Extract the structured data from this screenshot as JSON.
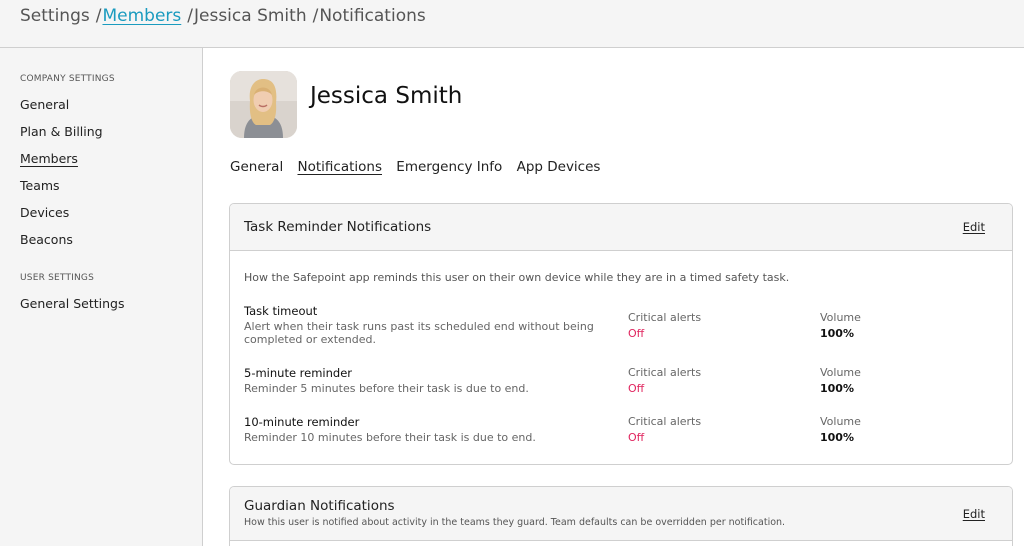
{
  "breadcrumb": {
    "settings": "Settings",
    "members": "Members",
    "member_name": "Jessica Smith",
    "current": "Notifications",
    "separator": "/"
  },
  "sidebar": {
    "company_heading": "COMPANY SETTINGS",
    "company_items": [
      "General",
      "Plan & Billing",
      "Members",
      "Teams",
      "Devices",
      "Beacons"
    ],
    "active_item": "Members",
    "user_heading": "USER SETTINGS",
    "user_items": [
      "General Settings"
    ]
  },
  "profile": {
    "name": "Jessica Smith"
  },
  "tabs": [
    "General",
    "Notifications",
    "Emergency Info",
    "App Devices"
  ],
  "active_tab": "Notifications",
  "task_card": {
    "title": "Task Reminder Notifications",
    "edit_label": "Edit",
    "description": "How the Safepoint app reminds this user on their own device while they are in a timed safety task.",
    "rows": [
      {
        "title": "Task timeout",
        "desc": "Alert when their task runs past its scheduled end without being completed or extended.",
        "alerts_label": "Critical alerts",
        "alerts_value": "Off",
        "volume_label": "Volume",
        "volume_value": "100%"
      },
      {
        "title": "5-minute reminder",
        "desc": "Reminder 5 minutes before their task is due to end.",
        "alerts_label": "Critical alerts",
        "alerts_value": "Off",
        "volume_label": "Volume",
        "volume_value": "100%"
      },
      {
        "title": "10-minute reminder",
        "desc": "Reminder 10 minutes before their task is due to end.",
        "alerts_label": "Critical alerts",
        "alerts_value": "Off",
        "volume_label": "Volume",
        "volume_value": "100%"
      }
    ]
  },
  "guardian_card": {
    "title": "Guardian Notifications",
    "subtitle": "How this user is notified about activity in the teams they guard. Team defaults can be overridden per notification.",
    "edit_label": "Edit"
  },
  "colors": {
    "link": "#1a9bbf",
    "off_status": "#e0245e",
    "panel_bg": "#f5f5f5",
    "border": "#cfcfcf"
  }
}
